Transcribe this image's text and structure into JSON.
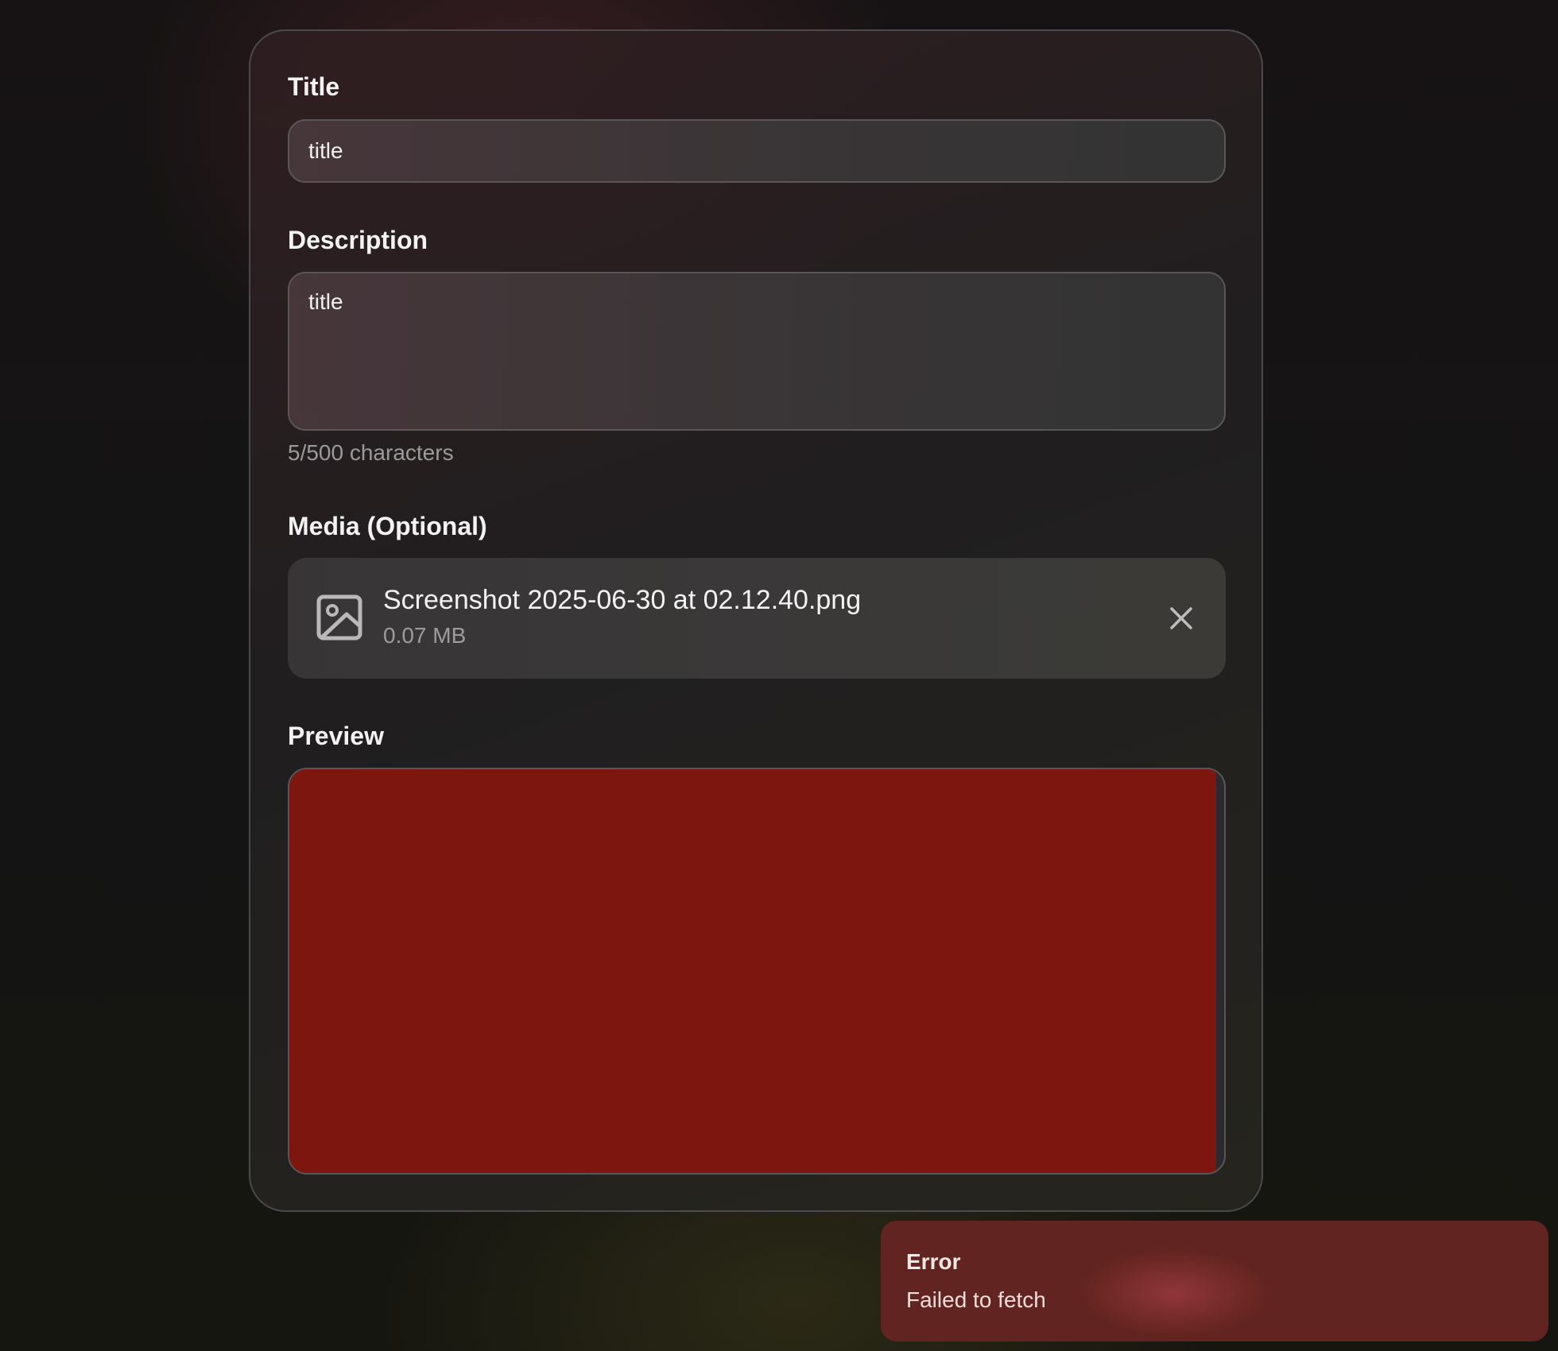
{
  "form": {
    "title_label": "Title",
    "title_value": "title",
    "description_label": "Description",
    "description_value": "title",
    "char_count": "5/500 characters",
    "media_label": "Media (Optional)",
    "preview_label": "Preview"
  },
  "media": {
    "file_name": "Screenshot 2025-06-30 at 02.12.40.png",
    "file_size": "0.07 MB",
    "icon": "image-icon",
    "remove_icon": "close-icon"
  },
  "preview": {
    "fill_color": "#7d160f"
  },
  "toast": {
    "title": "Error",
    "message": "Failed to fetch",
    "background": "#622420"
  }
}
